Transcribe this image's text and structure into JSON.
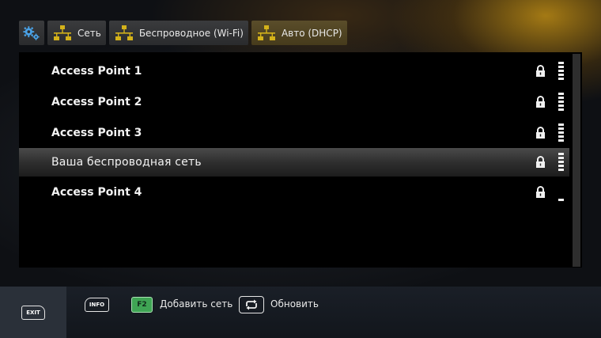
{
  "breadcrumb": {
    "settings_icon": "gear-icon",
    "items": [
      {
        "label": "Сеть",
        "icon": "network-icon"
      },
      {
        "label": "Беспроводное (Wi-Fi)",
        "icon": "network-icon"
      },
      {
        "label": "Авто (DHCP)",
        "icon": "network-icon"
      }
    ]
  },
  "networks": [
    {
      "name": "Access Point 1",
      "secured": true,
      "signal_bars": 5,
      "selected": false
    },
    {
      "name": "Access Point 2",
      "secured": true,
      "signal_bars": 5,
      "selected": false
    },
    {
      "name": "Access Point 3",
      "secured": true,
      "signal_bars": 5,
      "selected": false
    },
    {
      "name": "Ваша беспроводная сеть",
      "secured": true,
      "signal_bars": 5,
      "selected": true
    },
    {
      "name": "Access Point 4",
      "secured": true,
      "signal_bars": 1,
      "selected": false
    }
  ],
  "bottom_bar": {
    "exit_key": "EXIT",
    "info_key": "INFO",
    "f2_key": "F2",
    "f2_label": "Добавить сеть",
    "refresh_icon": "refresh-icon",
    "refresh_label": "Обновить"
  },
  "colors": {
    "accent_network_icon": "#d4b21a",
    "f2_key_green": "#3fa454",
    "selected_row": "#3a3a3a"
  }
}
